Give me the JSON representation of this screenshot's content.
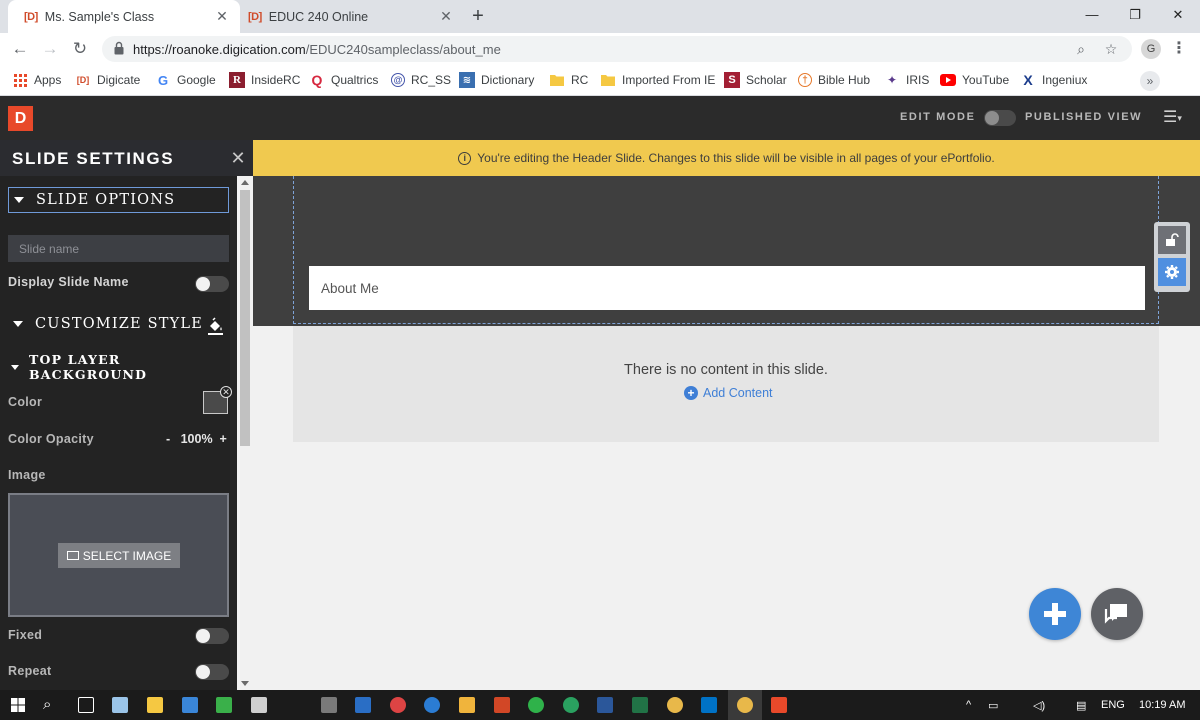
{
  "browser": {
    "tabs": [
      {
        "favicon": "[D]",
        "title": "Ms. Sample's Class",
        "active": true
      },
      {
        "favicon": "[D]",
        "title": "EDUC 240 Online",
        "active": false
      }
    ],
    "url_host": "https://roanoke.digication.com",
    "url_path": "/EDUC240sampleclass/about_me",
    "profile_initial": "G",
    "bookmarks": [
      {
        "label": "Apps",
        "icon": "apps-grid-icon",
        "color": "#e8492a"
      },
      {
        "label": "Digicate",
        "icon": "digication-icon",
        "color": "#d04b2a"
      },
      {
        "label": "Google",
        "icon": "google-icon",
        "color": "#4285f4"
      },
      {
        "label": "InsideRC",
        "icon": "insiderc-icon",
        "color": "#8b1e2f"
      },
      {
        "label": "Qualtrics",
        "icon": "qualtrics-icon",
        "color": "#d6283f"
      },
      {
        "label": "RC_SS",
        "icon": "rcss-icon",
        "color": "#4455aa"
      },
      {
        "label": "Dictionary",
        "icon": "dictionary-icon",
        "color": "#3a6fb0"
      },
      {
        "label": "RC",
        "icon": "folder-icon",
        "color": "#f5c842"
      },
      {
        "label": "Imported From IE",
        "icon": "folder-icon",
        "color": "#f5c842"
      },
      {
        "label": "Scholar",
        "icon": "scholar-icon",
        "color": "#a31f34"
      },
      {
        "label": "Bible Hub",
        "icon": "biblehub-icon",
        "color": "#e6782a"
      },
      {
        "label": "IRIS",
        "icon": "iris-icon",
        "color": "#5a3a8c"
      },
      {
        "label": "YouTube",
        "icon": "youtube-icon",
        "color": "#ff0000"
      },
      {
        "label": "Ingeniux",
        "icon": "ingeniux-icon",
        "color": "#1b3c8c"
      }
    ]
  },
  "appbar": {
    "logo": "D",
    "edit_mode": "EDIT MODE",
    "published_view": "PUBLISHED VIEW"
  },
  "panel": {
    "title": "SLIDE SETTINGS",
    "slide_options": "SLIDE OPTIONS",
    "slide_name_placeholder": "Slide name",
    "display_slide_name": "Display Slide Name",
    "customize_style": "CUSTOMIZE STYLE",
    "top_layer_background": "TOP LAYER BACKGROUND",
    "color_label": "Color",
    "color_value": "#4a4a4a",
    "color_opacity_label": "Color Opacity",
    "opacity_minus": "-",
    "opacity_value": "100%",
    "opacity_plus": "+",
    "image_label": "Image",
    "select_image": "SELECT IMAGE",
    "fixed_label": "Fixed",
    "repeat_label": "Repeat"
  },
  "main": {
    "notice": "You're editing the Header Slide. Changes to this slide will be visible in all pages of your ePortfolio.",
    "title_field": "About Me",
    "empty_message": "There is no content in this slide.",
    "add_content": "Add Content"
  },
  "taskbar": {
    "language": "ENG",
    "time": "10:19 AM"
  },
  "colors": {
    "accent": "#e8492a",
    "notice": "#f0c94f",
    "link": "#3f7fd6"
  }
}
